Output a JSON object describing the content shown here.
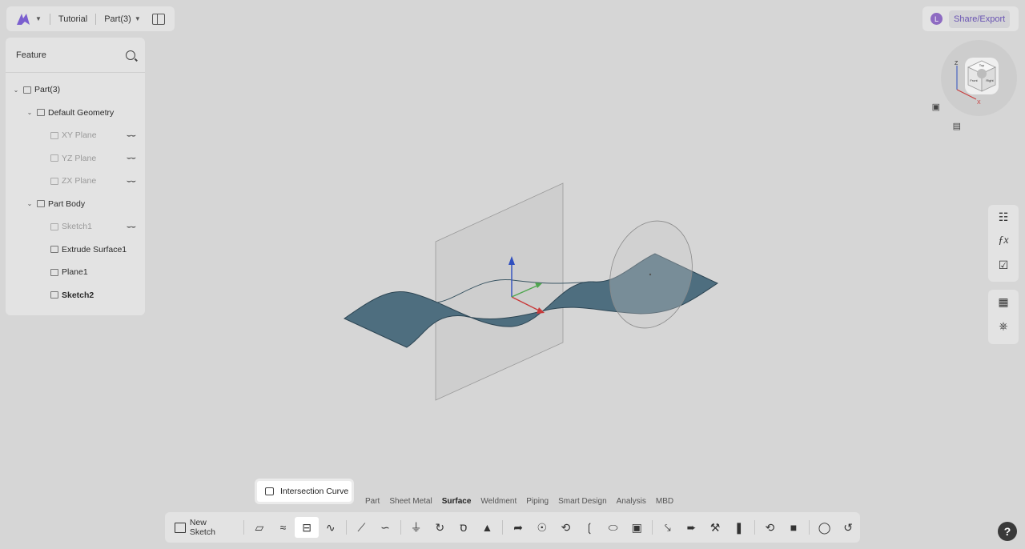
{
  "header": {
    "project": "Tutorial",
    "part": "Part(3)"
  },
  "user": {
    "initial": "L"
  },
  "share_label": "Share/Export",
  "feature_panel": {
    "title": "Feature",
    "tree": [
      {
        "label": "Part(3)",
        "level": 0,
        "expand": true,
        "faded": false,
        "bold": false,
        "eye": false
      },
      {
        "label": "Default Geometry",
        "level": 1,
        "expand": true,
        "faded": false,
        "bold": false,
        "eye": false
      },
      {
        "label": "XY Plane",
        "level": 2,
        "expand": false,
        "faded": true,
        "bold": false,
        "eye": true
      },
      {
        "label": "YZ Plane",
        "level": 2,
        "expand": false,
        "faded": true,
        "bold": false,
        "eye": true
      },
      {
        "label": "ZX Plane",
        "level": 2,
        "expand": false,
        "faded": true,
        "bold": false,
        "eye": true
      },
      {
        "label": "Part Body",
        "level": 1,
        "expand": true,
        "faded": false,
        "bold": false,
        "eye": false
      },
      {
        "label": "Sketch1",
        "level": 2,
        "expand": false,
        "faded": true,
        "bold": false,
        "eye": true
      },
      {
        "label": "Extrude Surface1",
        "level": 2,
        "expand": false,
        "faded": false,
        "bold": false,
        "eye": false
      },
      {
        "label": "Plane1",
        "level": 2,
        "expand": false,
        "faded": false,
        "bold": false,
        "eye": false
      },
      {
        "label": "Sketch2",
        "level": 2,
        "expand": false,
        "faded": false,
        "bold": true,
        "eye": false
      }
    ]
  },
  "viewcube": {
    "z": "Z",
    "x": "X",
    "top": "Top",
    "front": "Front",
    "right": "Right"
  },
  "tabs": [
    "Part",
    "Sheet Metal",
    "Surface",
    "Weldment",
    "Piping",
    "Smart Design",
    "Analysis",
    "MBD"
  ],
  "active_tab": "Surface",
  "toolbar": {
    "new_sketch": "New Sketch"
  },
  "tooltip": "Intersection Curve",
  "help": "?",
  "colors": {
    "accent": "#6a54b3",
    "surface": "#4f6f80",
    "plane": "#c9c9c9"
  }
}
